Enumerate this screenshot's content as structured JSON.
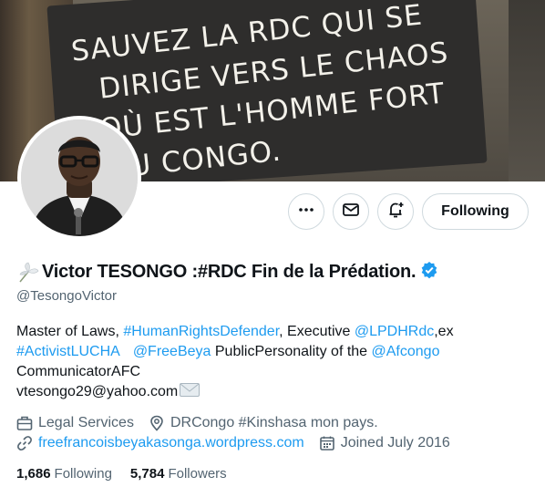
{
  "banner": {
    "sign_lines": [
      "SAUVEZ LA RDC QUI SE",
      "DIRIGE VERS LE CHAOS",
      "OÙ EST L'HOMME FORT",
      "DU CONGO."
    ]
  },
  "actions": {
    "more_icon": "more-icon",
    "message_icon": "message-icon",
    "notify_icon": "notification-bell-icon",
    "following_label": "Following"
  },
  "profile": {
    "display_name": "Victor TESONGO :#RDC Fin de la Prédation.",
    "handle": "@TesongoVictor"
  },
  "bio": {
    "t1": "Master of Laws, ",
    "l1": "#HumanRightsDefender",
    "t2": ", Executive ",
    "l2": "@LPDHRdc",
    "t3": ",ex",
    "l3": "#ActivistLUCHA",
    "l4": "@FreeBeya",
    "t4": " PublicPersonality of the ",
    "l5": "@Afcongo",
    "t5": "CommunicatorAFC",
    "t6": "vtesongo29@yahoo.com"
  },
  "meta": {
    "category": "Legal Services",
    "location": "DRCongo #Kinshasa mon pays.",
    "website": "freefrancoisbeyakasonga.wordpress.com",
    "joined": "Joined July 2016"
  },
  "stats": {
    "following_count": "1,686",
    "following_label": "Following",
    "followers_count": "5,784",
    "followers_label": "Followers"
  },
  "colors": {
    "accent": "#1d9bf0",
    "muted": "#536471",
    "text": "#0f1419"
  }
}
